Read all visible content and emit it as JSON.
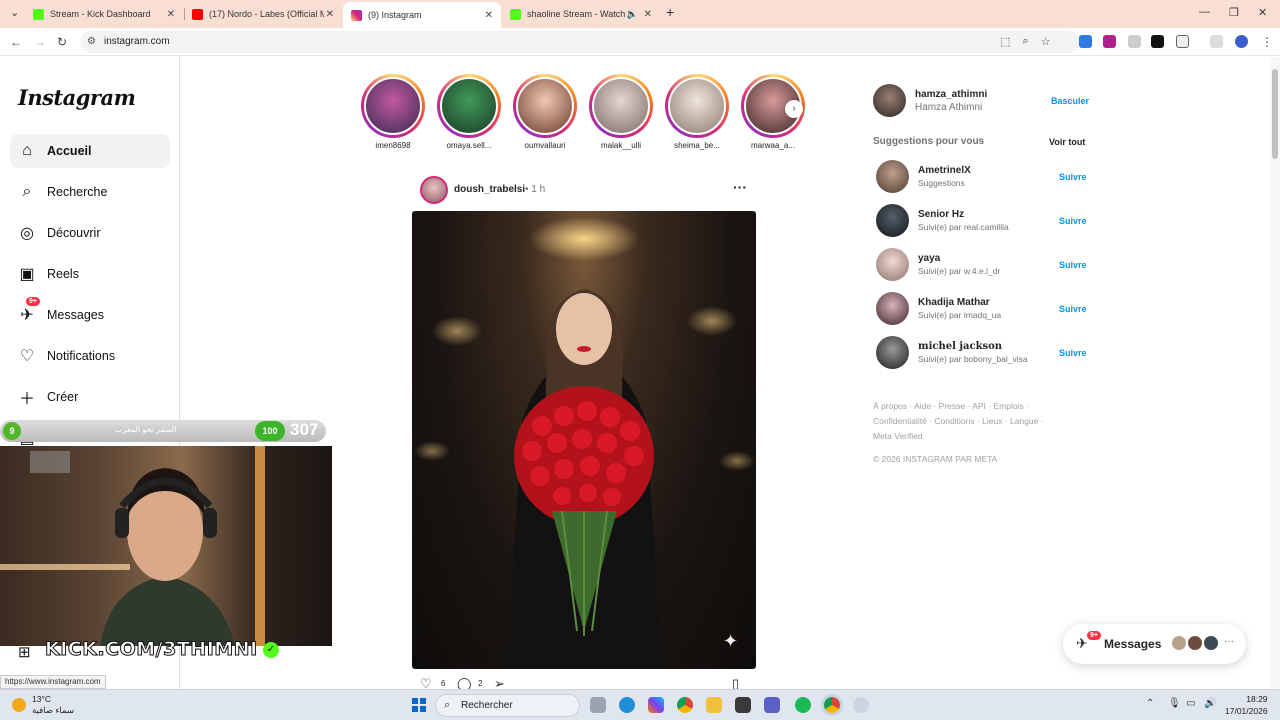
{
  "browser": {
    "tabs": [
      {
        "title": "Stream - Kick Dashboard",
        "color": "#53fc18"
      },
      {
        "title": "(17) Nordo - Labes (Official Mu",
        "color": "#ff0000"
      },
      {
        "title": "(9) Instagram",
        "color": "#d62976"
      },
      {
        "title": "shaoline Stream - Watch Li",
        "color": "#53fc18"
      }
    ],
    "url": "instagram.com"
  },
  "sidebar": {
    "logo": "Instagram",
    "items": [
      {
        "label": "Accueil",
        "icon": "home-icon"
      },
      {
        "label": "Recherche",
        "icon": "search-icon"
      },
      {
        "label": "Découvrir",
        "icon": "compass-icon"
      },
      {
        "label": "Reels",
        "icon": "reels-icon"
      },
      {
        "label": "Messages",
        "icon": "messenger-icon",
        "badge": "9+"
      },
      {
        "label": "Notifications",
        "icon": "heart-icon"
      },
      {
        "label": "Créer",
        "icon": "plus-icon"
      },
      {
        "label": "Tableau de bord",
        "icon": "dashboard-icon"
      }
    ]
  },
  "stories": [
    {
      "name": "imen8698"
    },
    {
      "name": "omaya.sell..."
    },
    {
      "name": "oumvallauri"
    },
    {
      "name": "malak__ulli"
    },
    {
      "name": "sheima_be..."
    },
    {
      "name": "marwaa_a..."
    }
  ],
  "post": {
    "username": "doush_trabelsi",
    "time": "1 h",
    "separator": "•",
    "likes": "6",
    "comments": "2"
  },
  "profile": {
    "username": "hamza_athimni",
    "fullname": "Hamza Athimni",
    "switch": "Basculer"
  },
  "suggestions": {
    "title": "Suggestions pour vous",
    "see_all": "Voir tout",
    "follow": "Suivre",
    "items": [
      {
        "name": "AmetrinelX",
        "sub": "Suggestions"
      },
      {
        "name": "Senior Hz",
        "sub": "Suivi(e) par real.camillia"
      },
      {
        "name": "yaya",
        "sub": "Suivi(e) par w.4.e.l_dr"
      },
      {
        "name": "Khadija Mathar",
        "sub": "Suivi(e) par imadq_ua"
      },
      {
        "name": "𝐦𝐢𝐜𝐡𝐞𝐥 𝐣𝐚𝐜𝐤𝐬𝐨𝐧",
        "sub": "Suivi(e) par bobony_bal_visa"
      }
    ]
  },
  "footer": {
    "links": "À propos · Aide · Presse · API · Emplois · Confidentialité · Conditions · Lieux · Langue · Meta Verified",
    "copyright": "© 2026 INSTAGRAM PAR META"
  },
  "messages_pill": {
    "label": "Messages",
    "badge": "9+"
  },
  "overlay": {
    "level": "9",
    "arabic": "السفر نحو المغرب",
    "progress_label": "100",
    "count": "307",
    "kick_tag": "KICK.COM/3THIMNI"
  },
  "status_url": "https://www.instagram.com",
  "taskbar": {
    "weather_temp": "13°C",
    "weather_desc": "سماء صافية",
    "search": "Rechercher",
    "time": "18:29",
    "date": "17/01/2026"
  }
}
